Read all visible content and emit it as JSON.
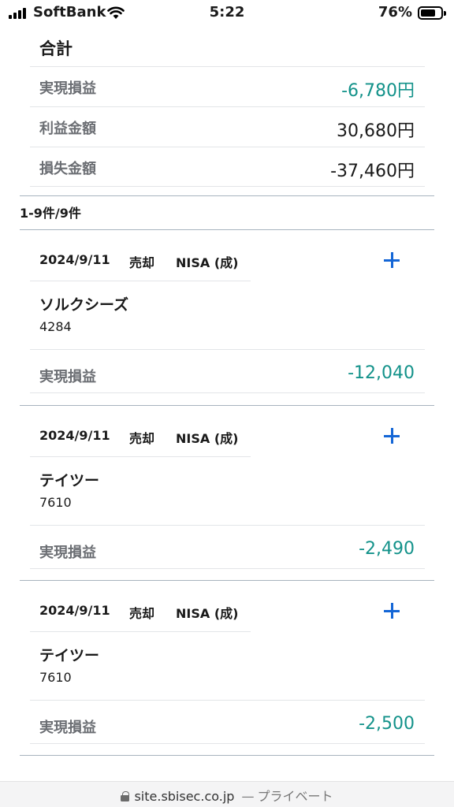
{
  "status_bar": {
    "carrier": "SoftBank",
    "time": "5:22",
    "battery_percent": "76%",
    "battery_level": 0.76,
    "icons": [
      "signal-icon",
      "wifi-icon",
      "battery-icon"
    ]
  },
  "summary": {
    "title": "合計",
    "rows": [
      {
        "label": "実現損益",
        "value": "-6,780円",
        "color": "#13928a"
      },
      {
        "label": "利益金額",
        "value": "30,680円",
        "color": "#1a1a1a"
      },
      {
        "label": "損失金額",
        "value": "-37,460円",
        "color": "#1a1a1a"
      }
    ]
  },
  "results": {
    "count_label": "1-9件/9件"
  },
  "trades": [
    {
      "date": "2024/9/11",
      "side": "売却",
      "account": "NISA (成)",
      "name": "ソルクシーズ",
      "code": "4284",
      "pl_label": "実現損益",
      "pl_value": "-12,040"
    },
    {
      "date": "2024/9/11",
      "side": "売却",
      "account": "NISA (成)",
      "name": "テイツー",
      "code": "7610",
      "pl_label": "実現損益",
      "pl_value": "-2,490"
    },
    {
      "date": "2024/9/11",
      "side": "売却",
      "account": "NISA (成)",
      "name": "テイツー",
      "code": "7610",
      "pl_label": "実現損益",
      "pl_value": "-2,500"
    }
  ],
  "url_bar": {
    "domain": "site.sbisec.co.jp",
    "separator": "—",
    "mode": "プライベート"
  },
  "colors": {
    "profit_loss": "#13928a",
    "accent": "#1466d6",
    "label_gray": "#6b6e73"
  }
}
